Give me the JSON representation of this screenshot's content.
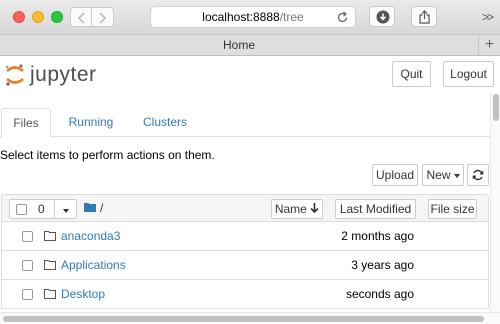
{
  "browser": {
    "url_host": "localhost:8888",
    "url_path": "/tree",
    "tab_title": "Home",
    "new_tab_symbol": "+",
    "overflow_symbol": ">>"
  },
  "header": {
    "brand": "jupyter",
    "quit_label": "Quit",
    "logout_label": "Logout"
  },
  "tabs": [
    {
      "label": "Files",
      "active": true
    },
    {
      "label": "Running",
      "active": false
    },
    {
      "label": "Clusters",
      "active": false
    }
  ],
  "hint": "Select items to perform actions on them.",
  "actions": {
    "upload_label": "Upload",
    "new_label": "New"
  },
  "list_header": {
    "selected_count": "0",
    "root_path": "/",
    "name_label": "Name",
    "last_modified_label": "Last Modified",
    "file_size_label": "File size"
  },
  "files": [
    {
      "name": "anaconda3",
      "modified": "2 months ago",
      "type": "folder"
    },
    {
      "name": "Applications",
      "modified": "3 years ago",
      "type": "folder"
    },
    {
      "name": "Desktop",
      "modified": "seconds ago",
      "type": "folder"
    }
  ],
  "colors": {
    "link": "#337ab7",
    "logo_orange": "#f37726",
    "folder_blue": "#337ab7"
  }
}
